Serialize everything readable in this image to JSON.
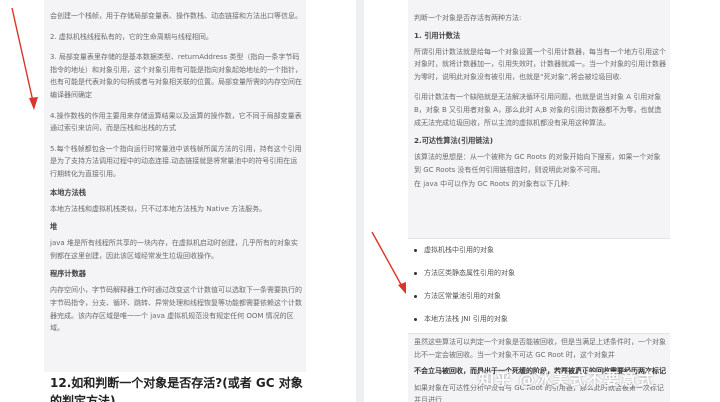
{
  "left": {
    "paras": [
      "会创建一个栈帧，用于存储局部变量表、操作数栈、动态链接和方法出口等信息。",
      "2. 虚拟机栈线程私有的，它的生命周期与线程相同。",
      "3. 局部变量表里存储的是基本数据类型、returnAddress 类型（指向一条字节码指令的地址）和对象引用，这个对象引用有可能是指向对象起始地址的一个指针，也有可能是代表对象的句柄或者与对象相关联的位置。局部变量所需的内存空间在编译器间确定",
      "4.操作数栈的作用主要用来存储运算结果以及运算的操作数，它不同于局部变量表通过索引来访问，而是压栈和出栈的方式",
      "5.每个栈帧都包含一个指向运行时常量池中该栈帧所属方法的引用，持有这个引用是为了支持方法调用过程中的动态连接.动态链接就是将常量池中的符号引用在运行期转化为直接引用。"
    ],
    "native_head": "本地方法栈",
    "native_text": "本地方法栈和虚拟机栈类似，只不过本地方法栈为 Native 方法服务。",
    "heap_head": "堆",
    "heap_text": "java 堆是所有线程所共享的一块内存，在虚拟机启动时创建，几乎所有的对象实例都在这里创建，因此该区域经常发生垃圾回收操作。",
    "pc_head": "程序计数器",
    "pc_text": "内存空间小，字节码解释器工作时通过改变这个计数值可以选取下一条需要执行的字节码指令，分支、循环、跳转、异常处理和线程恢复等功能都需要依赖这个计数器完成。该内存区域是唯一一个 java 虚拟机规范没有规定任何 OOM 情况的区域。",
    "heading": "12.如和判断一个对象是否存活?(或者 GC 对象的判定方法)"
  },
  "right": {
    "intro": "判断一个对象是否存活有两种方法:",
    "m1_head": "1. 引用计数法",
    "m1_p1": "所谓引用计数法就是给每一个对象设置一个引用计数器，每当有一个地方引用这个对象时，就将计数器加一，引用失效时，计数器就减一。当一个对象的引用计数器为零时，说明此对象没有被引用，也就是“死对象”,将会被垃圾回收.",
    "m1_p2": "引用计数法有一个缺陷就是无法解决循环引用问题，也就是说当对象 A 引用对象 B，对象 B 又引用者对象 A，那么此时 A,B 对象的引用计数器都不为零，也就造成无法完成垃圾回收，所以主流的虚拟机都没有采用这种算法。",
    "m2_head": "2.可达性算法(引用链法)",
    "m2_p1": "该算法的思想是：从一个被称为 GC Roots 的对象开始向下搜索，如果一个对象到 GC Roots 没有任何引用链相连时，则说明此对象不可用。",
    "m2_p2": "在 java 中可以作为 GC Roots 的对象有以下几种:",
    "bullets": [
      "虚拟机栈中引用的对象",
      "方法区类静态属性引用的对象",
      "方法区常量池引用的对象",
      "本地方法栈 JNI 引用的对象"
    ],
    "tail1": "虽然这些算法可以判定一个对象是否能被回收，但是当满足上述条件时，一个对象比不一定会被回收。当一个对象不可达 GC Root 时，这个对象并",
    "tail2": "不会立马被回收，而是出于一个死缓的阶段，若要被真正的回收需要经历两次标记",
    "tail3": "如果对象在可达性分析中没有与 GC Root 的引用链，那么此时就会被第一次标记并且进行"
  },
  "watermark": "知乎 @冰美式不要意式",
  "colors": {
    "arrow": "#d9352a",
    "gray_block": "#f4f4f6"
  }
}
